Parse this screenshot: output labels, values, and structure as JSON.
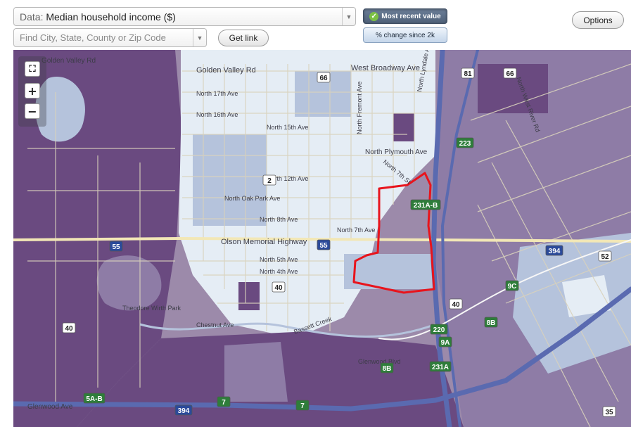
{
  "toolbar": {
    "data_prefix": "Data:",
    "data_value": "Median household income ($)",
    "search_placeholder": "Find City, State, County or Zip Code",
    "get_link_label": "Get link",
    "most_recent_label": "Most recent value",
    "pct_change_label": "% change since 2k",
    "options_label": "Options"
  },
  "map": {
    "colors": {
      "low": "#6a4a80",
      "mid_low": "#8e7ca6",
      "mid": "#b5c3dc",
      "high": "#e5edf5",
      "boundary": "#e8141c",
      "highway": "#5a6ab0",
      "background": "#9c8aaa"
    },
    "zoom_controls": [
      "zoom-extent",
      "zoom-in",
      "zoom-out"
    ],
    "labels": [
      {
        "text": "Golden Valley Rd"
      },
      {
        "text": "Golden Valley Rd"
      },
      {
        "text": "West Broadway Ave"
      },
      {
        "text": "North 17th Ave"
      },
      {
        "text": "North 16th Ave"
      },
      {
        "text": "North 15th Ave"
      },
      {
        "text": "North Plymouth Ave"
      },
      {
        "text": "North 12th Ave"
      },
      {
        "text": "North Oak Park Ave"
      },
      {
        "text": "North 8th Ave"
      },
      {
        "text": "North 7th Ave"
      },
      {
        "text": "Olson Memorial Highway"
      },
      {
        "text": "North 5th Ave"
      },
      {
        "text": "North 4th Ave"
      },
      {
        "text": "Theodore Wirth Park"
      },
      {
        "text": "Chestnut Ave"
      },
      {
        "text": "Bassett Creek"
      },
      {
        "text": "Glenwood Blvd"
      },
      {
        "text": "Glenwood Ave"
      },
      {
        "text": "North 7th St"
      },
      {
        "text": "North West River Rd"
      },
      {
        "text": "North Lyndale Ave"
      },
      {
        "text": "North Fremont Ave"
      }
    ],
    "shields": [
      {
        "text": "66"
      },
      {
        "text": "81"
      },
      {
        "text": "66"
      },
      {
        "text": "2"
      },
      {
        "text": "55"
      },
      {
        "text": "55"
      },
      {
        "text": "40"
      },
      {
        "text": "40"
      },
      {
        "text": "40"
      },
      {
        "text": "52"
      },
      {
        "text": "35"
      },
      {
        "text": "394"
      },
      {
        "text": "394"
      },
      {
        "text": "223"
      },
      {
        "text": "231A-B"
      },
      {
        "text": "9C"
      },
      {
        "text": "8B"
      },
      {
        "text": "220"
      },
      {
        "text": "9A"
      },
      {
        "text": "231A"
      },
      {
        "text": "8B"
      },
      {
        "text": "5A-B"
      },
      {
        "text": "7"
      },
      {
        "text": "7"
      }
    ]
  }
}
